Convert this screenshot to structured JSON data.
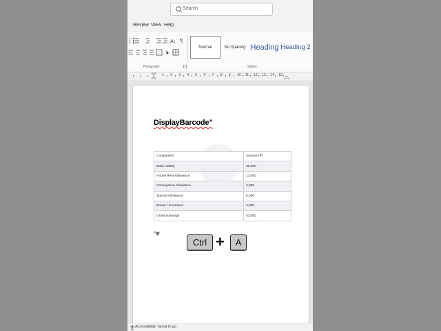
{
  "search": {
    "placeholder": "Search"
  },
  "menu": [
    {
      "label": "Review"
    },
    {
      "label": "View"
    },
    {
      "label": "Help"
    }
  ],
  "ribbon": {
    "groups": {
      "paragraph": "Paragraph",
      "styles": "Styles"
    },
    "styles": [
      {
        "label": "Normal"
      },
      {
        "label": "No Spacing"
      },
      {
        "label": "Heading"
      },
      {
        "label": "Heading 2"
      }
    ]
  },
  "ruler": {
    "numbers": [
      "1",
      "2",
      "3",
      "4",
      "5",
      "6",
      "7",
      "8",
      "9",
      "10",
      "11",
      "12",
      "13",
      "14",
      "15"
    ]
  },
  "document": {
    "title": "DisplayBarcode”",
    "watermark": "XL",
    "table": {
      "headers": [
        "Component",
        "Amount (₹)"
      ],
      "rows": [
        [
          "Basic Salary",
          "30,000"
        ],
        [
          "House Rent Allowance",
          "12,000"
        ],
        [
          "Conveyance Allowance",
          "2,000"
        ],
        [
          "Special Allowance",
          "5,000"
        ],
        [
          "Bonus / Incentives",
          "3,000"
        ],
        [
          "Gross Earnings",
          "52,000"
        ]
      ]
    },
    "stray_text": "“qr"
  },
  "keys": {
    "ctrl": "Ctrl",
    "plus": "+",
    "a": "A"
  },
  "status": {
    "accessibility": "Accessibility: Good to go"
  },
  "colors": {
    "heading": "#2f5597",
    "accent_row": "#f1eef5",
    "spellcheck": "#e02020"
  }
}
